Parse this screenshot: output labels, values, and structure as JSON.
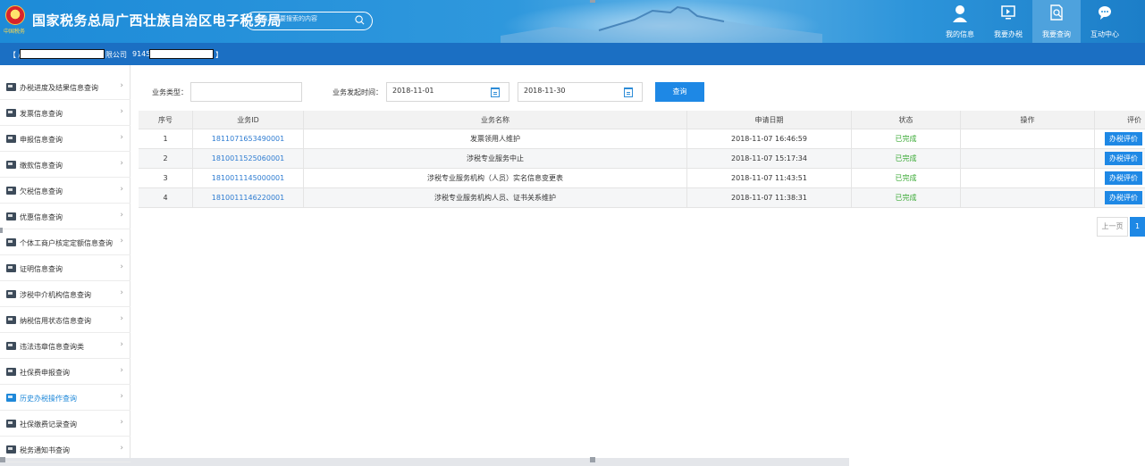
{
  "header": {
    "emblem_caption": "中国税务",
    "title": "国家税务总局广西壮族自治区电子税务局",
    "search_placeholder": "请输入需要搜索的内容",
    "nav": [
      {
        "label": "我的信息",
        "icon": "user-icon"
      },
      {
        "label": "我要办税",
        "icon": "monitor-icon"
      },
      {
        "label": "我要查询",
        "icon": "search-doc-icon",
        "active": true
      },
      {
        "label": "互动中心",
        "icon": "chat-icon"
      }
    ]
  },
  "infobar": {
    "company_prefix": "【 /",
    "company_suffix": "限公司",
    "taxid_prefix": "9145",
    "close_bracket": "】"
  },
  "sidebar": {
    "items": [
      {
        "label": "办税进度及结果信息查询"
      },
      {
        "label": "发票信息查询"
      },
      {
        "label": "申报信息查询"
      },
      {
        "label": "缴款信息查询"
      },
      {
        "label": "欠税信息查询"
      },
      {
        "label": "优惠信息查询"
      },
      {
        "label": "个体工商户核定定额信息查询"
      },
      {
        "label": "证明信息查询"
      },
      {
        "label": "涉税中介机构信息查询"
      },
      {
        "label": "纳税信用状态信息查询"
      },
      {
        "label": "违法违章信息查询类"
      },
      {
        "label": "社保费申报查询"
      },
      {
        "label": "历史办税操作查询",
        "active": true
      },
      {
        "label": "社保缴费记录查询"
      },
      {
        "label": "税务通知书查询"
      }
    ]
  },
  "filters": {
    "type_label": "业务类型：",
    "type_value": "",
    "time_label": "业务发起时间：",
    "start_date": "2018-11-01",
    "end_date": "2018-11-30",
    "query_button": "查询"
  },
  "table": {
    "headers": [
      "序号",
      "业务ID",
      "业务名称",
      "申请日期",
      "状态",
      "操作",
      "评价"
    ],
    "rows": [
      {
        "no": "1",
        "id": "1811071653490001",
        "name": "发票领用人维护",
        "date": "2018-11-07 16:46:59",
        "status": "已完成",
        "action": "",
        "eval": "办税评价"
      },
      {
        "no": "2",
        "id": "1810011525060001",
        "name": "涉税专业服务中止",
        "date": "2018-11-07 15:17:34",
        "status": "已完成",
        "action": "",
        "eval": "办税评价"
      },
      {
        "no": "3",
        "id": "1810011145000001",
        "name": "涉税专业服务机构（人员）实名信息变更表",
        "date": "2018-11-07 11:43:51",
        "status": "已完成",
        "action": "",
        "eval": "办税评价"
      },
      {
        "no": "4",
        "id": "1810011146220001",
        "name": "涉税专业服务机构人员、证书关系维护",
        "date": "2018-11-07 11:38:31",
        "status": "已完成",
        "action": "",
        "eval": "办税评价"
      }
    ]
  },
  "pager": {
    "prev": "上一页",
    "current": "1"
  },
  "colors": {
    "accent": "#1e88e5",
    "status_done": "#3aaa35",
    "link": "#2e7cd1"
  }
}
